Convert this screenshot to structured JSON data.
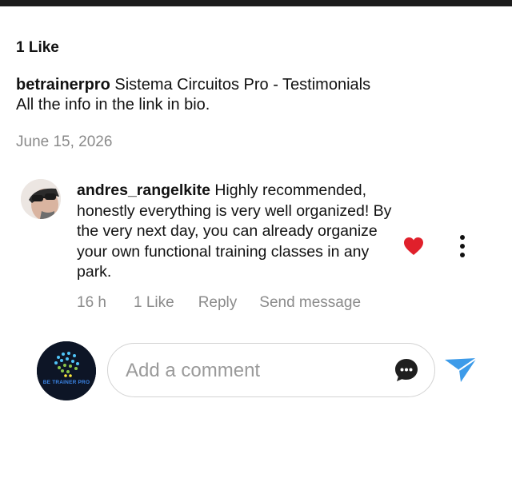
{
  "post": {
    "likes_text": "1 Like",
    "caption": {
      "username": "betrainerpro",
      "line1": " Sistema Circuitos Pro - Testimonials",
      "line2": "All the info in the link in bio."
    },
    "date": "June 15, 2026"
  },
  "comment": {
    "username": "andres_rangelkite",
    "text": " Highly recommended, honestly everything is very well organized! By the very next day, you can already organize your own functional training classes in any park.",
    "time": "16 h",
    "likes": "1 Like",
    "reply_label": "Reply",
    "send_message_label": "Send message",
    "heart_color": "#e0202b"
  },
  "composer": {
    "placeholder": "Add a comment",
    "avatar_text": "BE TRAINER PRO",
    "send_color": "#3d9be9"
  },
  "icons": {
    "like": "heart-icon",
    "options": "more-options-icon",
    "emoji": "chat-bubble-icon",
    "send": "send-icon"
  }
}
